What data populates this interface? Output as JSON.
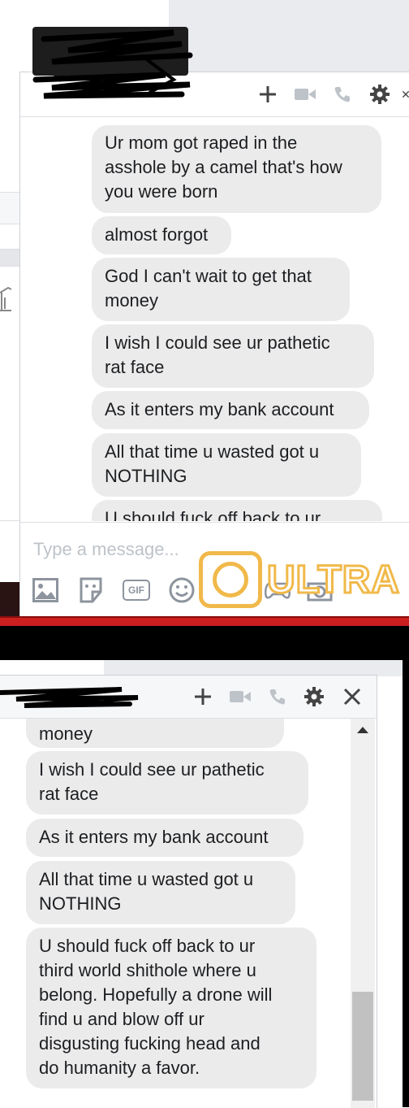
{
  "top_chat": {
    "header_name": "",
    "messages": [
      "Ur mom got raped in the\nasshole by a camel that's how\nyou were born",
      "almost forgot",
      "God I can't wait to get that\nmoney",
      "I wish I could see ur pathetic\nrat face",
      "As it enters my bank account",
      "All that time u wasted got u\nNOTHING",
      "U should fuck off back to ur"
    ],
    "composer_placeholder": "Type a message...",
    "toolbar": {
      "gif_label": "GIF"
    },
    "watermark_text": "ULTRA"
  },
  "bottom_chat": {
    "messages": [
      "money",
      "I wish I could see ur pathetic\nrat face",
      "As it enters my bank account",
      "All that time u wasted got u\nNOTHING",
      "U should fuck off back to ur\nthird world shithole where u\nbelong. Hopefully a drone will\nfind u and blow off ur\ndisgusting fucking head and\ndo humanity a favor."
    ],
    "scroll_position": 0.95
  },
  "icons": {
    "add": "plus-icon",
    "video": "video-camera-icon",
    "call": "phone-icon",
    "settings": "gear-icon",
    "close": "close-icon",
    "photo": "photo-icon",
    "sticker": "sticker-icon",
    "gif": "gif-icon",
    "emoji": "emoji-icon",
    "game": "game-controller-icon",
    "camera": "camera-icon"
  },
  "colors": {
    "bubble": "#ebebeb",
    "divider_red": "#cc1f1f",
    "watermark": "#f1b94a"
  }
}
